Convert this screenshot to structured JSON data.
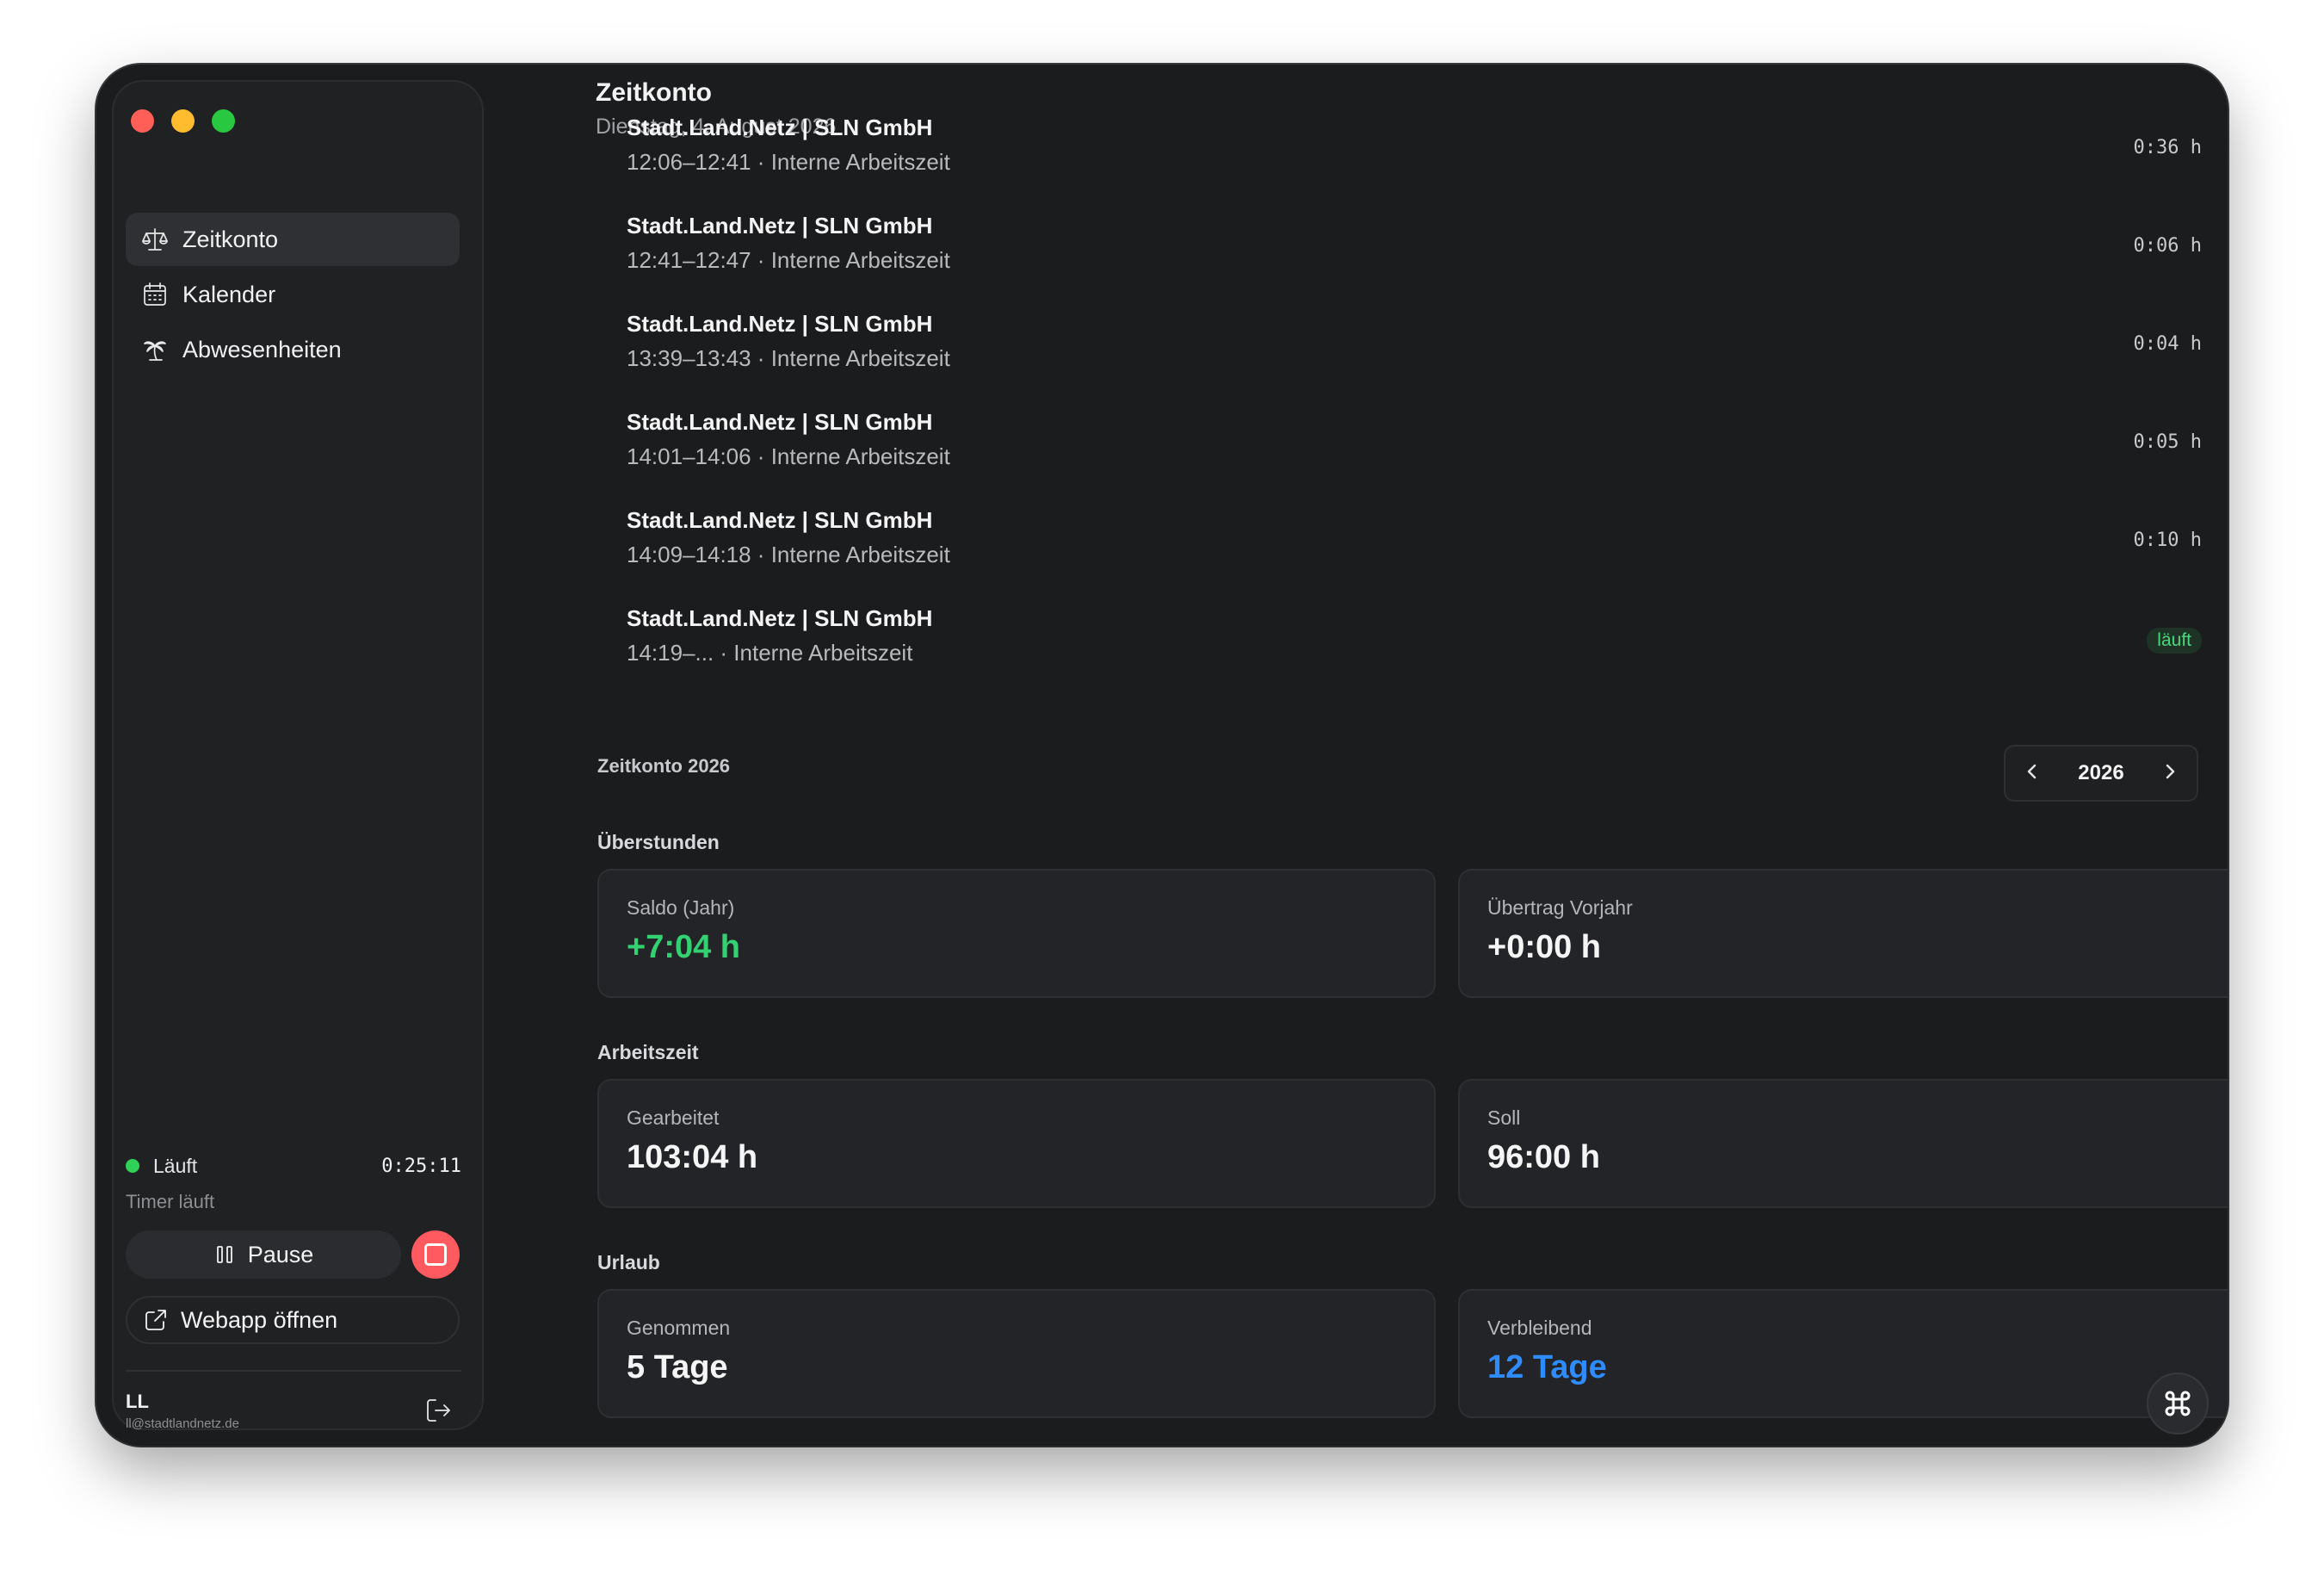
{
  "sidebar": {
    "nav": [
      {
        "label": "Zeitkonto",
        "icon": "scale-icon",
        "active": true
      },
      {
        "label": "Kalender",
        "icon": "calendar-icon",
        "active": false
      },
      {
        "label": "Abwesenheiten",
        "icon": "palm-tree-icon",
        "active": false
      }
    ],
    "status": {
      "label": "Läuft",
      "timer": "0:25:11",
      "subtext": "Timer läuft",
      "pause_label": "Pause",
      "webapp_label": "Webapp öffnen"
    },
    "user": {
      "initials": "LL",
      "email": "ll@stadtlandnetz.de"
    }
  },
  "header": {
    "title": "Zeitkonto",
    "date": "Dienstag, 4. August 2026"
  },
  "entries": [
    {
      "title": "Stadt.Land.Netz | SLN GmbH",
      "subtitle": "12:06–12:41 · Interne Arbeitszeit",
      "duration": "0:36  h"
    },
    {
      "title": "Stadt.Land.Netz | SLN GmbH",
      "subtitle": "12:41–12:47 · Interne Arbeitszeit",
      "duration": "0:06  h"
    },
    {
      "title": "Stadt.Land.Netz | SLN GmbH",
      "subtitle": "13:39–13:43 · Interne Arbeitszeit",
      "duration": "0:04  h"
    },
    {
      "title": "Stadt.Land.Netz | SLN GmbH",
      "subtitle": "14:01–14:06 · Interne Arbeitszeit",
      "duration": "0:05  h"
    },
    {
      "title": "Stadt.Land.Netz | SLN GmbH",
      "subtitle": "14:09–14:18 · Interne Arbeitszeit",
      "duration": "0:10  h"
    },
    {
      "title": "Stadt.Land.Netz | SLN GmbH",
      "subtitle": "14:19–... · Interne Arbeitszeit",
      "badge": "läuft"
    }
  ],
  "account": {
    "title": "Zeitkonto 2026",
    "year": "2026",
    "overtime": {
      "title": "Überstunden",
      "saldo_label": "Saldo (Jahr)",
      "saldo_value": "+7:04 h",
      "carry_label": "Übertrag Vorjahr",
      "carry_value": "+0:00 h"
    },
    "worktime": {
      "title": "Arbeitszeit",
      "worked_label": "Gearbeitet",
      "worked_value": "103:04 h",
      "target_label": "Soll",
      "target_value": "96:00 h"
    },
    "vacation": {
      "title": "Urlaub",
      "taken_label": "Genommen",
      "taken_value": "5 Tage",
      "remaining_label": "Verbleibend",
      "remaining_value": "12 Tage"
    }
  },
  "colors": {
    "accent_green": "#34d173",
    "accent_blue": "#2f8cff",
    "stop_red": "#ff5a5f"
  }
}
